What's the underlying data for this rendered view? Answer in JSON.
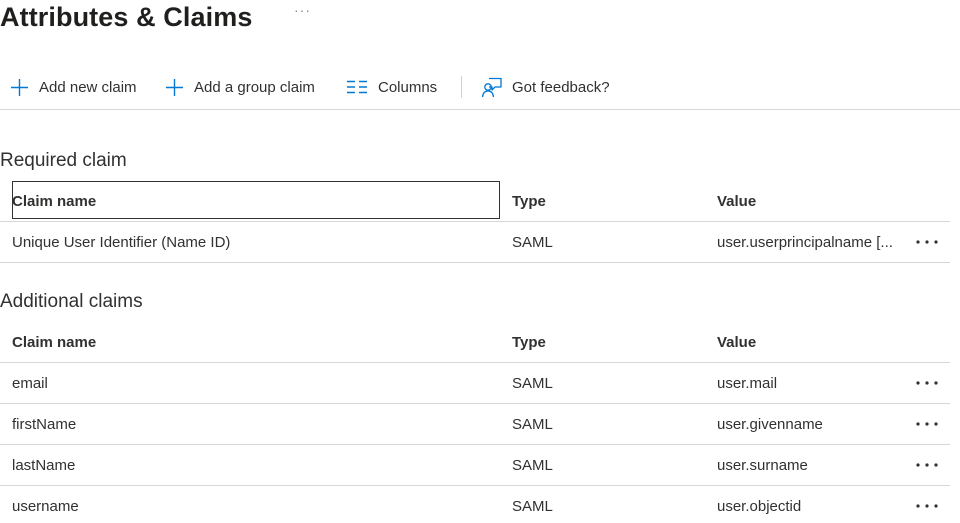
{
  "page": {
    "title": "Attributes & Claims",
    "more_label": "···"
  },
  "toolbar": {
    "add_claim_label": "Add new claim",
    "add_group_claim_label": "Add a group claim",
    "columns_label": "Columns",
    "feedback_label": "Got feedback?"
  },
  "required": {
    "section_title": "Required claim",
    "headers": {
      "name": "Claim name",
      "type": "Type",
      "value": "Value"
    },
    "rows": [
      {
        "name": "Unique User Identifier (Name ID)",
        "type": "SAML",
        "value": "user.userprincipalname [..."
      }
    ]
  },
  "additional": {
    "section_title": "Additional claims",
    "headers": {
      "name": "Claim name",
      "type": "Type",
      "value": "Value"
    },
    "rows": [
      {
        "name": "email",
        "type": "SAML",
        "value": "user.mail"
      },
      {
        "name": "firstName",
        "type": "SAML",
        "value": "user.givenname"
      },
      {
        "name": "lastName",
        "type": "SAML",
        "value": "user.surname"
      },
      {
        "name": "username",
        "type": "SAML",
        "value": "user.objectid"
      }
    ]
  },
  "icons": {
    "add": "plus-icon",
    "columns": "columns-icon",
    "feedback": "feedback-icon",
    "row_more": "more-icon"
  },
  "colors": {
    "accent": "#0078d4",
    "text": "#323130",
    "divider": "#d6d6d6"
  }
}
